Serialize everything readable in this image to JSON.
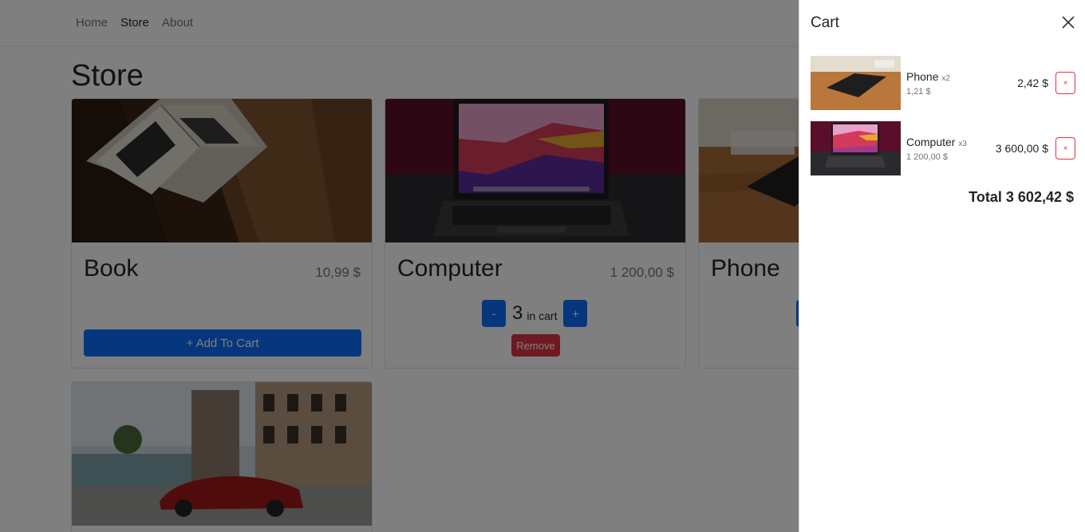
{
  "nav": {
    "links": [
      {
        "label": "Home",
        "active": false
      },
      {
        "label": "Store",
        "active": true
      },
      {
        "label": "About",
        "active": false
      }
    ]
  },
  "store": {
    "title": "Store",
    "items": [
      {
        "name": "Book",
        "price": "10,99 $",
        "add_label": "+ Add To Cart",
        "image": "open-book-on-wooden-table"
      },
      {
        "name": "Computer",
        "price": "1 200,00 $",
        "quantity": "3",
        "quantity_unit": "in cart",
        "decrease_label": "-",
        "increase_label": "+",
        "remove_label": "Remove",
        "image": "laptop-on-dark-background"
      },
      {
        "name": "Phone",
        "increase_label": "+",
        "image": "phone-on-wooden-table"
      },
      {
        "name": "",
        "image": "red-car-in-city-street"
      }
    ]
  },
  "cart": {
    "title": "Cart",
    "close_icon": "close-icon",
    "items": [
      {
        "name": "Phone",
        "qty": "x2",
        "unit_price": "1,21 $",
        "total": "2,42 $",
        "remove_label": "×",
        "image": "phone-on-wooden-table"
      },
      {
        "name": "Computer",
        "qty": "x3",
        "unit_price": "1 200,00 $",
        "total": "3 600,00 $",
        "remove_label": "×",
        "image": "laptop-on-dark-background"
      }
    ],
    "total_label": "Total 3 602,42 $"
  },
  "colors": {
    "primary": "#0d6efd",
    "danger": "#dc3545",
    "muted": "#6c757d",
    "backdrop": "rgba(0,0,0,0.5)"
  }
}
